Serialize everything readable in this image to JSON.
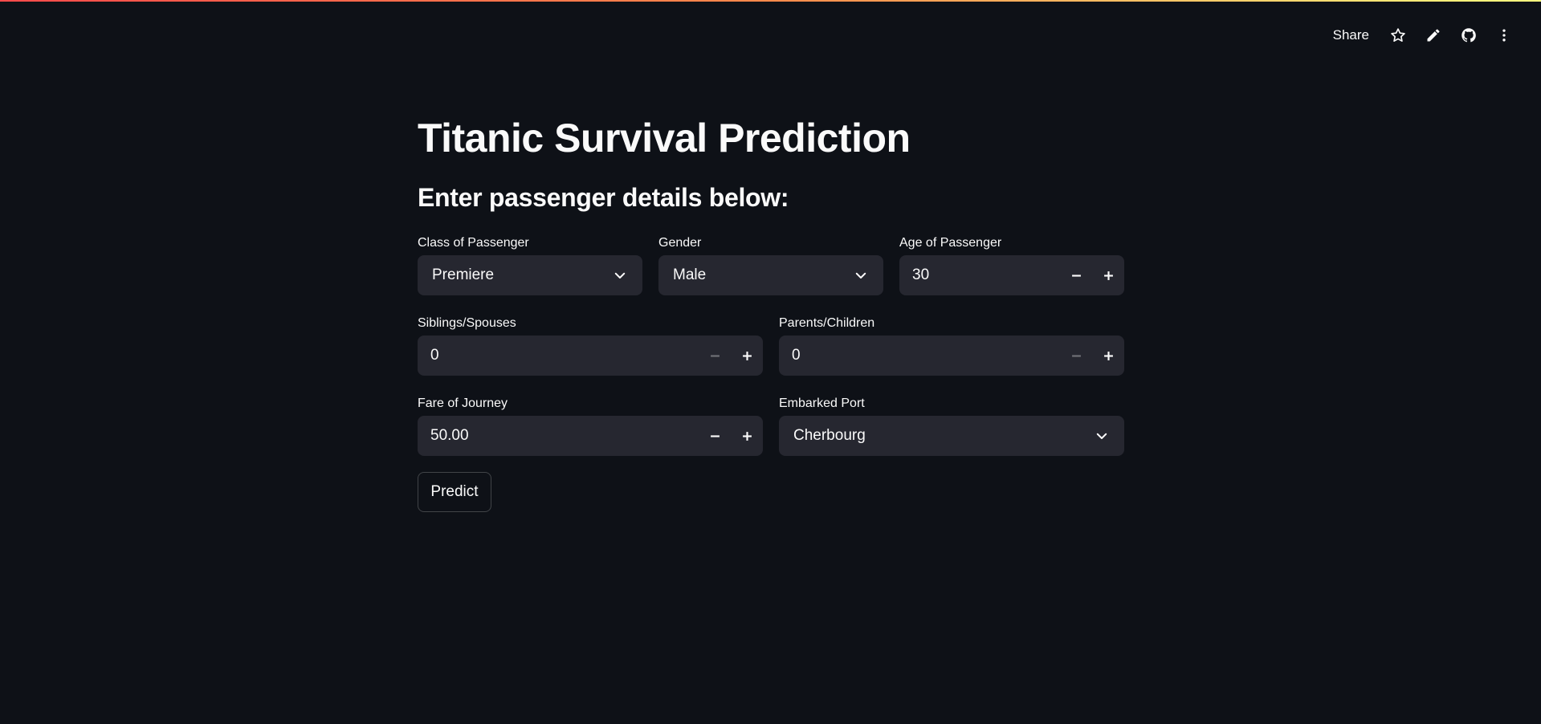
{
  "toolbar": {
    "share_label": "Share",
    "icons": [
      "star-icon",
      "pencil-icon",
      "github-icon",
      "more-vertical-icon"
    ]
  },
  "page": {
    "title": "Titanic Survival Prediction",
    "subheader": "Enter passenger details below:"
  },
  "form": {
    "pclass": {
      "label": "Class of Passenger",
      "value": "Premiere"
    },
    "gender": {
      "label": "Gender",
      "value": "Male"
    },
    "age": {
      "label": "Age of Passenger",
      "value": "30"
    },
    "sibsp": {
      "label": "Siblings/Spouses",
      "value": "0"
    },
    "parch": {
      "label": "Parents/Children",
      "value": "0"
    },
    "fare": {
      "label": "Fare of Journey",
      "value": "50.00"
    },
    "embarked": {
      "label": "Embarked Port",
      "value": "Cherbourg"
    },
    "predict_label": "Predict"
  },
  "colors": {
    "background": "#0e1117",
    "input_bg": "#262730",
    "text": "#fafafa",
    "accent_gradient": [
      "#ff4b4b",
      "#fffd80"
    ]
  }
}
